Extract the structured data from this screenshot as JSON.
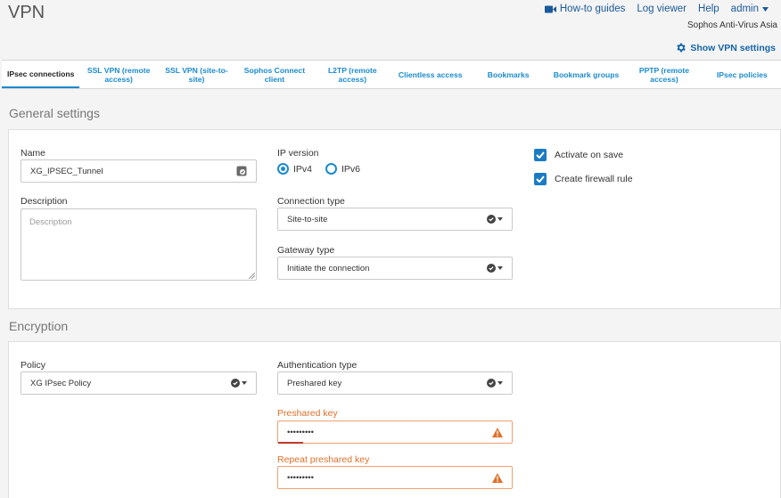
{
  "header": {
    "title": "VPN",
    "links": {
      "guides": "How-to guides",
      "log": "Log viewer",
      "help": "Help",
      "user": "admin"
    },
    "org": "Sophos Anti-Virus Asia",
    "show_settings": "Show VPN settings"
  },
  "tabs": [
    "IPsec connections",
    "SSL VPN (remote access)",
    "SSL VPN (site-to-site)",
    "Sophos Connect client",
    "L2TP (remote access)",
    "Clientless access",
    "Bookmarks",
    "Bookmark groups",
    "PPTP (remote access)",
    "IPsec policies"
  ],
  "general": {
    "title": "General settings",
    "name_label": "Name",
    "name_value": "XG_IPSEC_Tunnel",
    "description_label": "Description",
    "description_placeholder": "Description",
    "ip_version_label": "IP version",
    "ipv4": "IPv4",
    "ipv6": "IPv6",
    "connection_type_label": "Connection type",
    "connection_type_value": "Site-to-site",
    "gateway_type_label": "Gateway type",
    "gateway_type_value": "Initiate the connection",
    "activate_on_save": "Activate on save",
    "create_firewall_rule": "Create firewall rule"
  },
  "encryption": {
    "title": "Encryption",
    "policy_label": "Policy",
    "policy_value": "XG IPsec Policy",
    "auth_type_label": "Authentication type",
    "auth_type_value": "Preshared key",
    "psk_label": "Preshared key",
    "psk_value": "•••••••••",
    "repeat_psk_label": "Repeat preshared key",
    "repeat_psk_value": "•••••••••"
  },
  "colors": {
    "accent": "#1a8ad0",
    "warning": "#e0702a"
  }
}
